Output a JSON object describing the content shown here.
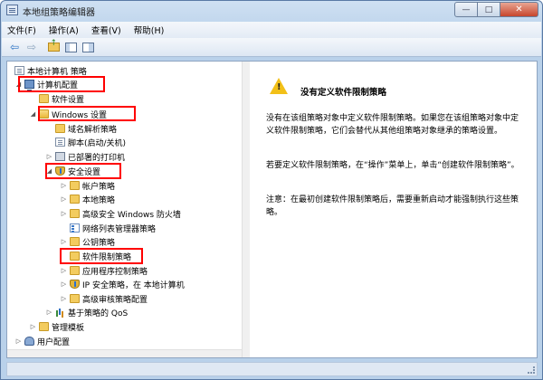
{
  "window": {
    "title": "本地组策略编辑器",
    "minimize_glyph": "—",
    "maximize_glyph": "□",
    "close_glyph": "✕"
  },
  "menu": [
    "文件(F)",
    "操作(A)",
    "查看(V)",
    "帮助(H)"
  ],
  "toolbar": {
    "back_glyph": "⇦",
    "forward_glyph": "⇨",
    "icons": [
      "back-arrow-icon",
      "forward-arrow-icon",
      "up-folder-icon",
      "show-tree-icon",
      "help-pane-icon"
    ]
  },
  "tree": [
    {
      "label": "本地计算机 策略",
      "twisty": "",
      "icon": "policy"
    },
    {
      "label": "计算机配置",
      "twisty": "◢",
      "icon": "computer"
    },
    {
      "label": "软件设置",
      "twisty": "",
      "icon": "folder"
    },
    {
      "label": "Windows 设置",
      "twisty": "◢",
      "icon": "folder-open"
    },
    {
      "label": "域名解析策略",
      "twisty": "",
      "icon": "folder"
    },
    {
      "label": "脚本(启动/关机)",
      "twisty": "",
      "icon": "doc"
    },
    {
      "label": "已部署的打印机",
      "twisty": "▷",
      "icon": "printer"
    },
    {
      "label": "安全设置",
      "twisty": "◢",
      "icon": "shield"
    },
    {
      "label": "帐户策略",
      "twisty": "▷",
      "icon": "folder"
    },
    {
      "label": "本地策略",
      "twisty": "▷",
      "icon": "folder"
    },
    {
      "label": "高级安全 Windows 防火墙",
      "twisty": "▷",
      "icon": "folder"
    },
    {
      "label": "网络列表管理器策略",
      "twisty": "",
      "icon": "netlist"
    },
    {
      "label": "公钥策略",
      "twisty": "▷",
      "icon": "folder"
    },
    {
      "label": "软件限制策略",
      "twisty": "",
      "icon": "folder"
    },
    {
      "label": "应用程序控制策略",
      "twisty": "▷",
      "icon": "folder"
    },
    {
      "label": "IP 安全策略，在 本地计算机",
      "twisty": "▷",
      "icon": "shield"
    },
    {
      "label": "高级审核策略配置",
      "twisty": "▷",
      "icon": "folder"
    },
    {
      "label": "基于策略的 QoS",
      "twisty": "▷",
      "icon": "chart"
    },
    {
      "label": "管理模板",
      "twisty": "▷",
      "icon": "folder"
    },
    {
      "label": "用户配置",
      "twisty": "▷",
      "icon": "users"
    }
  ],
  "description": {
    "title": "没有定义软件限制策略",
    "paragraphs": [
      "没有在该组策略对象中定义软件限制策略。如果您在该组策略对象中定义软件限制策略，它们会替代从其他组策略对象继承的策略设置。",
      "若要定义软件限制策略，在“操作”菜单上，单击“创建软件限制策略”。",
      "注意：在最初创建软件限制策略后，需要重新启动才能强制执行这些策略。"
    ],
    "warning_mark": "!"
  },
  "colors": {
    "highlight": "#ff0000",
    "warning": "#f2c018"
  }
}
